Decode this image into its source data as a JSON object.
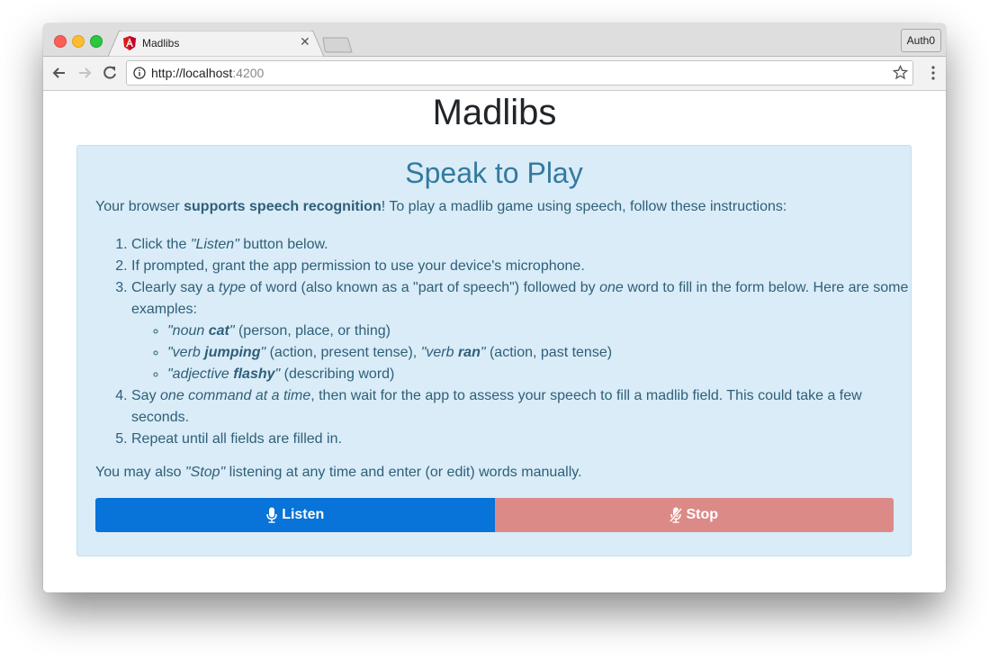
{
  "browser": {
    "tab": {
      "title": "Madlibs",
      "favicon": "angular-icon"
    },
    "profile_button": "Auth0",
    "url": {
      "host": "http://localhost",
      "port": ":4200"
    }
  },
  "page": {
    "title": "Madlibs",
    "alert": {
      "heading": "Speak to Play",
      "intro": {
        "pre": "Your browser ",
        "bold": "supports speech recognition",
        "post": "! To play a madlib game using speech, follow these instructions:"
      },
      "steps": {
        "s1": {
          "pre": "Click the ",
          "em": "\"Listen\"",
          "post": " button below."
        },
        "s2": {
          "text": "If prompted, grant the app permission to use your device's microphone."
        },
        "s3": {
          "pre": "Clearly say a ",
          "em1": "type",
          "mid": " of word (also known as a \"part of speech\") followed by ",
          "em2": "one",
          "post": " word to fill in the form below. Here are some examples:"
        },
        "examples": {
          "e1": {
            "q1": "\"noun ",
            "b": "cat",
            "q2": "\"",
            "desc": " (person, place, or thing)"
          },
          "e2": {
            "q1": "\"verb ",
            "b": "jumping",
            "q2": "\"",
            "desc": " (action, present tense), ",
            "q3": "\"verb ",
            "b2": "ran",
            "q4": "\"",
            "desc2": " (action, past tense)"
          },
          "e3": {
            "q1": "\"adjective ",
            "b": "flashy",
            "q2": "\"",
            "desc": " (describing word)"
          }
        },
        "s4": {
          "pre": "Say ",
          "em": "one command at a time",
          "post": ", then wait for the app to assess your speech to fill a madlib field. This could take a few seconds."
        },
        "s5": {
          "text": "Repeat until all fields are filled in."
        }
      },
      "outro": {
        "pre": "You may also ",
        "em": "\"Stop\"",
        "post": " listening at any time and enter (or edit) words manually."
      },
      "buttons": {
        "listen": "Listen",
        "stop": "Stop"
      }
    }
  },
  "colors": {
    "listen": "#0873d8",
    "stop": "#dc8a88",
    "alert_bg": "#d9ecf7",
    "alert_text": "#2f5f79"
  }
}
